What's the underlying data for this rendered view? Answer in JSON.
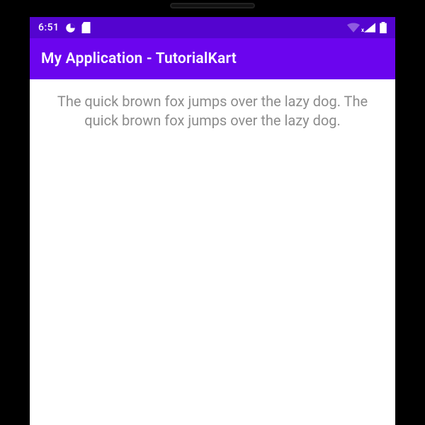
{
  "status": {
    "time": "6:51",
    "icons": {
      "left1": "pie-icon",
      "left2": "sd-card-icon",
      "wifi": "wifi-icon",
      "signal": "signal-icon",
      "signal_badge": "x",
      "battery": "battery-icon"
    }
  },
  "appbar": {
    "title": "My Application - TutorialKart"
  },
  "content": {
    "body": "The quick brown fox jumps over the lazy dog. The quick brown fox jumps over the lazy dog."
  },
  "colors": {
    "status_bg": "#5404cf",
    "appbar_bg": "#6b05ee",
    "text_body": "#8c8c8c"
  }
}
